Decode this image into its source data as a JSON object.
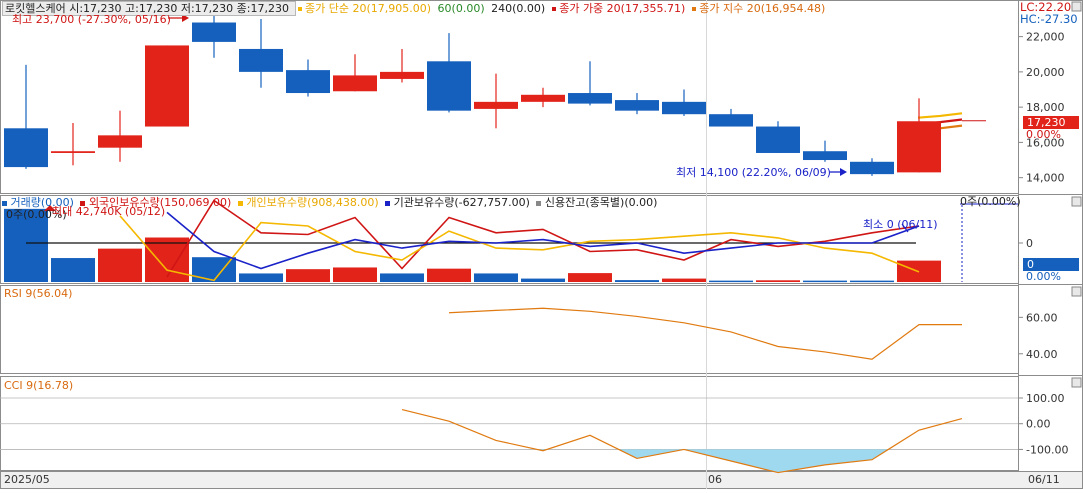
{
  "colors": {
    "up": "#e2231a",
    "down": "#1560bd",
    "sma": "#f5b800",
    "wma": "#d01515",
    "ema": "#e07a10",
    "blue": "#1a22c8",
    "grid": "#b4b4b4",
    "indicator": "#e07a10",
    "cci_fill": "#9fd9f0"
  },
  "header": {
    "name": "로킷헬스케어",
    "ohlc": "시:17,230 고:17,230 저:17,230 종:17,230",
    "sma": "종가 단순 20(17,905.00)",
    "ma60": "60(0.00)",
    "ma240": "240(0.00)",
    "wma": "종가 가중 20(17,355.71)",
    "ema": "종가 지수 20(16,954.48)"
  },
  "badges": {
    "lc": "LC:22.20",
    "hc": "HC:-27.30",
    "price_tag": "17,230",
    "price_pct": "0.00%",
    "vol_tag": "0",
    "vol_pct": "0.00%"
  },
  "annotations": {
    "max": "최고 23,700 (-27.30%, 05/16)",
    "min": "최저 14,100 (22.20%, 06/09)",
    "vol_max": "최대 42,740K (05/12)",
    "vol_min": "최소 0 (06/11)",
    "vol_left": "0주(0.00%)",
    "vol_right": "0주(0.00%)"
  },
  "panels": {
    "volume_legend": [
      "거래량(0.00)",
      "외국인보유수량(150,069.00)",
      "개인보유수량(908,438.00)",
      "기관보유수량(-627,757.00)",
      "신용잔고(종목별)(0.00)"
    ],
    "rsi_label": "RSI 9(56.04)",
    "cci_label": "CCI 9(16.78)"
  },
  "axes": {
    "price_ticks": [
      "22,000",
      "20,000",
      "18,000",
      "16,000",
      "14,000"
    ],
    "vol_ticks": [
      "0"
    ],
    "rsi_ticks": [
      "60.00",
      "40.00"
    ],
    "cci_ticks": [
      "100.00",
      "0.00",
      "-100.00"
    ],
    "date_left": "2025/05",
    "date_mid": "06",
    "date_right": "06/11"
  },
  "chart_data": [
    {
      "type": "candlestick",
      "ylim": [
        13300,
        23850
      ],
      "candles": [
        {
          "o": 16800,
          "h": 20400,
          "l": 14500,
          "c": 14600
        },
        {
          "o": 15400,
          "h": 17100,
          "l": 14700,
          "c": 15500
        },
        {
          "o": 15700,
          "h": 17800,
          "l": 14900,
          "c": 16400
        },
        {
          "o": 16900,
          "h": 21500,
          "l": 16900,
          "c": 21500
        },
        {
          "o": 22800,
          "h": 23700,
          "l": 20800,
          "c": 21700
        },
        {
          "o": 21300,
          "h": 23000,
          "l": 19100,
          "c": 20000
        },
        {
          "o": 20100,
          "h": 20700,
          "l": 18600,
          "c": 18800
        },
        {
          "o": 18900,
          "h": 21000,
          "l": 18900,
          "c": 19800
        },
        {
          "o": 19600,
          "h": 21300,
          "l": 19400,
          "c": 20000
        },
        {
          "o": 20600,
          "h": 22200,
          "l": 17700,
          "c": 17800
        },
        {
          "o": 17900,
          "h": 19900,
          "l": 16800,
          "c": 18300
        },
        {
          "o": 18300,
          "h": 19100,
          "l": 18000,
          "c": 18700
        },
        {
          "o": 18800,
          "h": 20600,
          "l": 18100,
          "c": 18200
        },
        {
          "o": 18400,
          "h": 18800,
          "l": 17600,
          "c": 17800
        },
        {
          "o": 18300,
          "h": 19000,
          "l": 17500,
          "c": 17600
        },
        {
          "o": 17600,
          "h": 17900,
          "l": 16900,
          "c": 16900
        },
        {
          "o": 16900,
          "h": 17200,
          "l": 15400,
          "c": 15400
        },
        {
          "o": 15500,
          "h": 16100,
          "l": 14900,
          "c": 15000
        },
        {
          "o": 14900,
          "h": 15100,
          "l": 14100,
          "c": 14200
        },
        {
          "o": 14300,
          "h": 18500,
          "l": 14300,
          "c": 17200
        }
      ],
      "sma_tail": [
        17400,
        17500,
        17650
      ],
      "wma_tail": [
        17000,
        17150,
        17300
      ],
      "ema_tail": [
        16700,
        16800,
        16950
      ]
    },
    {
      "type": "bar",
      "volumes": [
        42740,
        14000,
        19500,
        26000,
        14500,
        5000,
        7500,
        8500,
        5000,
        7800,
        5000,
        2000,
        5200,
        1100,
        2000,
        800,
        1000,
        800,
        800,
        12500
      ],
      "volume_up": [
        false,
        false,
        true,
        true,
        false,
        false,
        true,
        true,
        false,
        true,
        false,
        false,
        true,
        false,
        true,
        false,
        true,
        false,
        false,
        true
      ],
      "ylim": [
        0,
        45000
      ],
      "series": [
        {
          "name": "외국인보유수량",
          "values": [
            null,
            null,
            null,
            -2,
            2.5,
            0.6,
            0.5,
            1.5,
            -1.5,
            1.5,
            0.6,
            0.8,
            -0.5,
            -0.4,
            -1.0,
            0.2,
            -0.2,
            0.1,
            0.6,
            1.0
          ]
        },
        {
          "name": "개인보유수량",
          "values": [
            null,
            null,
            1.6,
            -1.6,
            -2.2,
            1.2,
            1.0,
            -0.5,
            -1.0,
            0.7,
            -0.3,
            -0.4,
            0.1,
            0.2,
            0.4,
            0.6,
            0.3,
            -0.3,
            -0.6,
            -1.7
          ]
        },
        {
          "name": "기관보유수량",
          "values": [
            null,
            null,
            null,
            1.8,
            -0.5,
            -1.5,
            -0.6,
            0.2,
            -0.3,
            0.1,
            0.0,
            0.2,
            -0.2,
            0.0,
            -0.6,
            -0.3,
            0.0,
            0.0,
            0.0,
            1.0
          ]
        }
      ]
    },
    {
      "type": "line",
      "name": "RSI 9",
      "ylim": [
        30,
        75
      ],
      "values": [
        null,
        null,
        null,
        null,
        null,
        null,
        null,
        null,
        null,
        62.5,
        63.8,
        65,
        63.3,
        60.5,
        57,
        52,
        44,
        41,
        37,
        56,
        56
      ]
    },
    {
      "type": "line",
      "name": "CCI 9",
      "ylim": [
        -180,
        170
      ],
      "values": [
        null,
        null,
        null,
        null,
        null,
        null,
        null,
        null,
        55,
        10,
        -65,
        -105,
        -45,
        -135,
        -100,
        -145,
        -190,
        -160,
        -140,
        -25,
        20
      ]
    }
  ]
}
